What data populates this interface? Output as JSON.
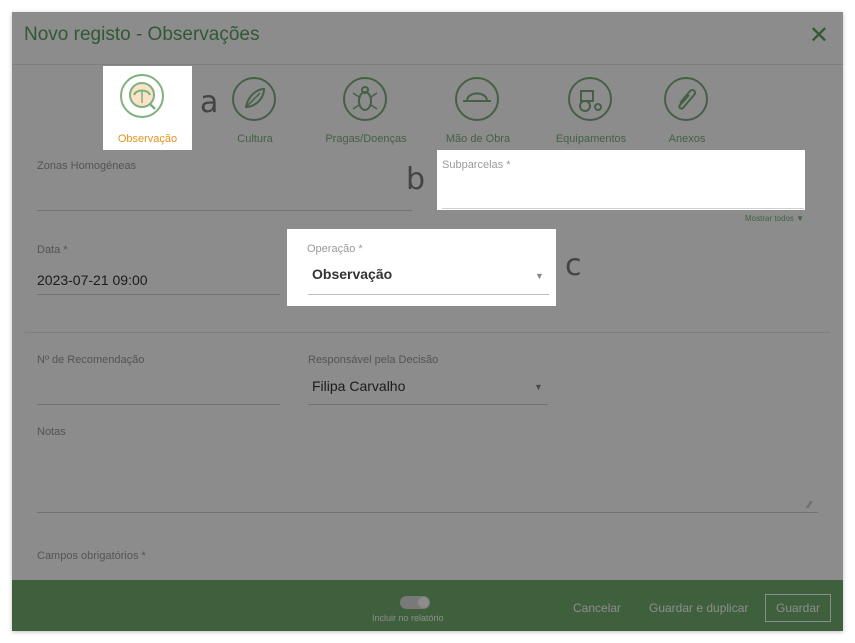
{
  "dialog": {
    "title": "Novo registo - Observações",
    "close": "✕"
  },
  "tabs": [
    {
      "label": "Observação",
      "icon": "magnifier-plant-icon",
      "active": true
    },
    {
      "label": "Cultura",
      "icon": "leaf-icon"
    },
    {
      "label": "Pragas/Doenças",
      "icon": "bug-icon"
    },
    {
      "label": "Mão de Obra",
      "icon": "worker-hat-icon"
    },
    {
      "label": "Equipamentos",
      "icon": "tractor-icon"
    },
    {
      "label": "Anexos",
      "icon": "paperclip-icon"
    }
  ],
  "form": {
    "zonas": {
      "label": "Zonas Homogéneas",
      "value": ""
    },
    "subparcelas": {
      "label": "Subparcelas *",
      "value": "",
      "show_all": "Mostrar todos ▼"
    },
    "data": {
      "label": "Data *",
      "value": "2023-07-21 09:00"
    },
    "operacao": {
      "label": "Operação *",
      "value": "Observação"
    },
    "recomendacao": {
      "label": "Nº de Recomendação",
      "value": ""
    },
    "responsavel": {
      "label": "Responsável pela Decisão",
      "value": "Filipa Carvalho"
    },
    "notas": {
      "label": "Notas",
      "value": ""
    },
    "required_note": "Campos obrigatórios *"
  },
  "footer": {
    "toggle_label": "Incluir no relatório",
    "cancel": "Cancelar",
    "save_duplicate": "Guardar e duplicar",
    "save": "Guardar"
  },
  "markers": {
    "a": "a",
    "b": "b",
    "c": "c"
  },
  "colors": {
    "accent": "#5aa25f",
    "active_tab": "#e69422",
    "footer": "#72b06f"
  }
}
